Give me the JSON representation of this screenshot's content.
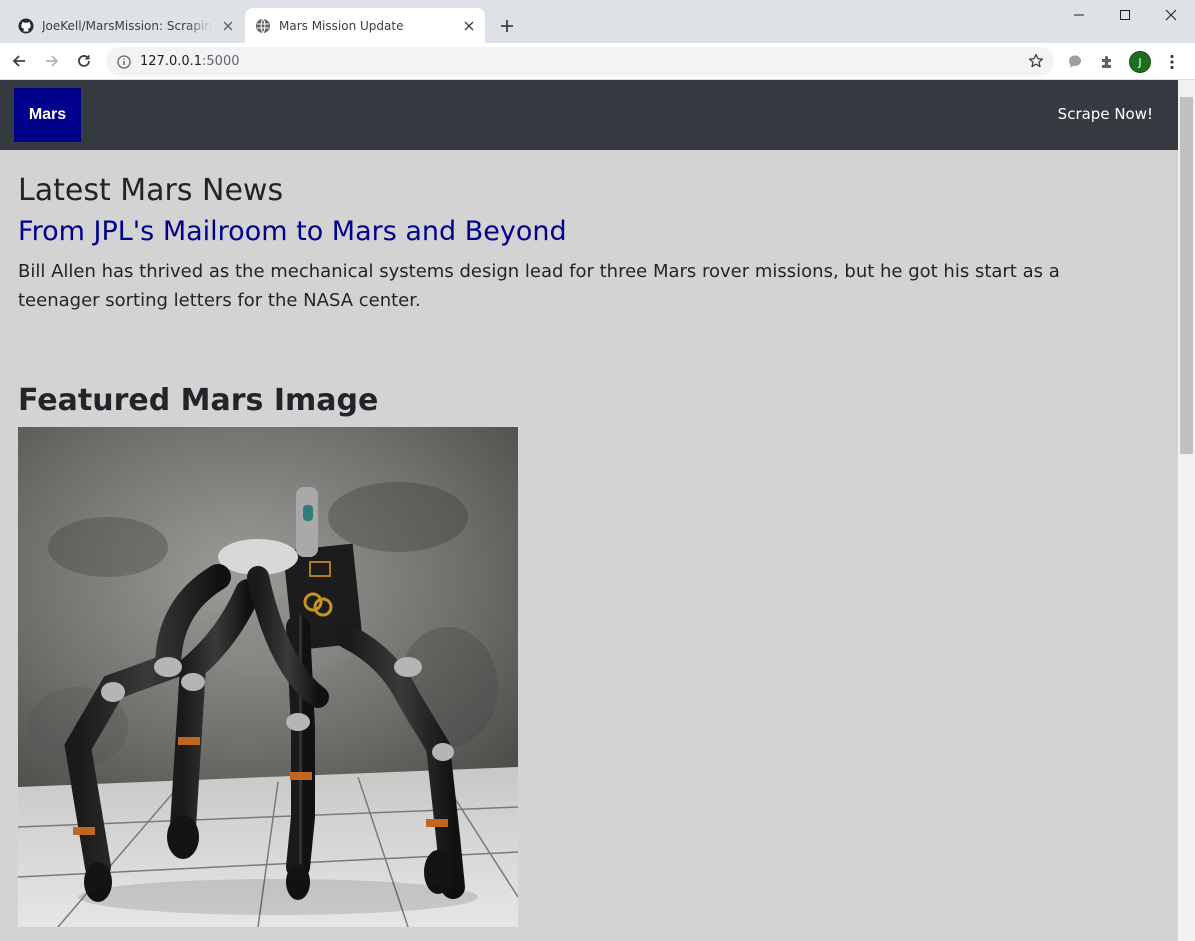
{
  "browser": {
    "tabs": [
      {
        "title": "JoeKell/MarsMission: Scraping im",
        "favicon": "github-icon",
        "active": false
      },
      {
        "title": "Mars Mission Update",
        "favicon": "globe-icon",
        "active": true
      }
    ],
    "url_host": "127.0.0.1",
    "url_port": ":5000",
    "profile_initial": "J"
  },
  "navbar": {
    "brand": "Mars",
    "scrape_label": "Scrape Now!"
  },
  "news": {
    "heading": "Latest Mars News",
    "title": "From JPL's Mailroom to Mars and Beyond",
    "paragraph": "Bill Allen has thrived as the mechanical systems design lead for three Mars rover missions, but he got his start as a teenager sorting letters for the NASA center."
  },
  "featured": {
    "heading": "Featured Mars Image"
  },
  "colors": {
    "navbar_bg": "#343a40",
    "brand_bg": "#00008b",
    "page_bg": "#d3d3d3",
    "link": "#00008b"
  }
}
